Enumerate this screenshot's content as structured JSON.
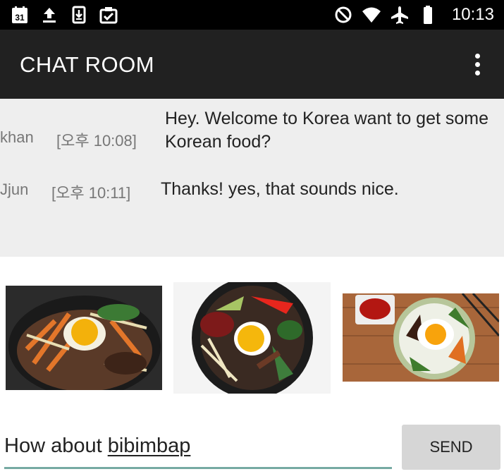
{
  "status_bar": {
    "calendar_day": "31",
    "time": "10:13",
    "icons": [
      "calendar-icon",
      "upload-icon",
      "download-icon",
      "clipboard-check-icon",
      "do-not-disturb-icon",
      "wifi-icon",
      "airplane-icon",
      "battery-icon"
    ]
  },
  "toolbar": {
    "title": "CHAT ROOM",
    "menu_icon": "overflow-menu-icon"
  },
  "messages": [
    {
      "sender": "khan",
      "time": "[오후 10:08]",
      "text": "Hey. Welcome to Korea want to get some Korean food?"
    },
    {
      "sender": "Jjun",
      "time": "[오후 10:11]",
      "text": "Thanks! yes, that sounds nice."
    }
  ],
  "images": [
    "bibimbap-photo-1",
    "bibimbap-photo-2",
    "bibimbap-photo-3"
  ],
  "composer": {
    "text_prefix": "How about ",
    "text_underlined": "bibimbap",
    "send_label": "SEND"
  },
  "colors": {
    "status_bar": "#000000",
    "toolbar": "#212121",
    "chat_bg": "#eeeeee",
    "input_underline": "#76aaa3",
    "send_button": "#d6d6d6"
  }
}
